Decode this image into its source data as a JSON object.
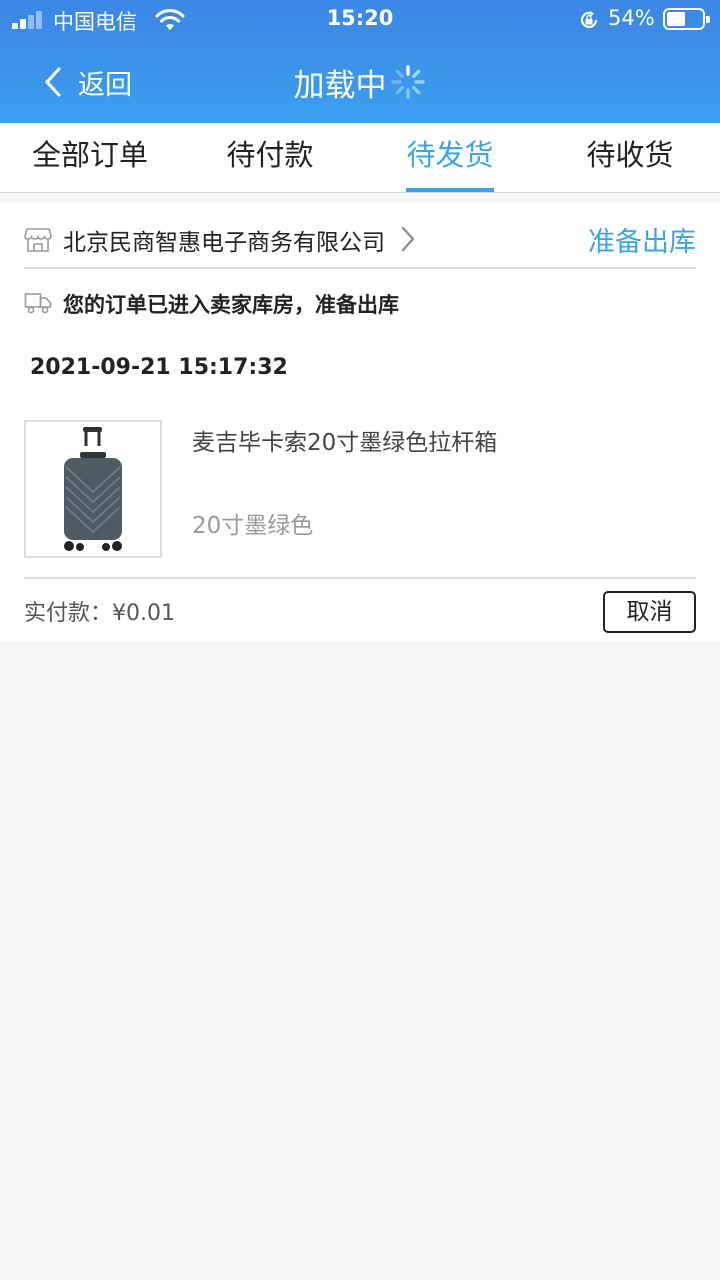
{
  "status_bar": {
    "carrier": "中国电信",
    "time": "15:20",
    "battery_percent": "54%",
    "battery_level": 0.54,
    "signal_bars": 2,
    "icons": [
      "signal-icon",
      "wifi-icon",
      "rotation-lock-icon",
      "battery-icon"
    ]
  },
  "nav": {
    "back_label": "返回",
    "title": "加载中"
  },
  "tabs": [
    {
      "label": "全部订单",
      "active": false
    },
    {
      "label": "待付款",
      "active": false
    },
    {
      "label": "待发货",
      "active": true
    },
    {
      "label": "待收货",
      "active": false
    }
  ],
  "order": {
    "shop_name": "北京民商智惠电子商务有限公司",
    "status": "准备出库",
    "shipping_message": "您的订单已进入卖家库房，准备出库",
    "datetime": "2021-09-21 15:17:32",
    "product": {
      "name": "麦吉毕卡索20寸墨绿色拉杆箱",
      "spec": "20寸墨绿色"
    },
    "paid_label": "实付款：¥0.01",
    "cancel_label": "取消"
  },
  "colors": {
    "header_blue": "#3c95ea",
    "accent": "#3aa3ea",
    "background": "#f6f6f6"
  }
}
